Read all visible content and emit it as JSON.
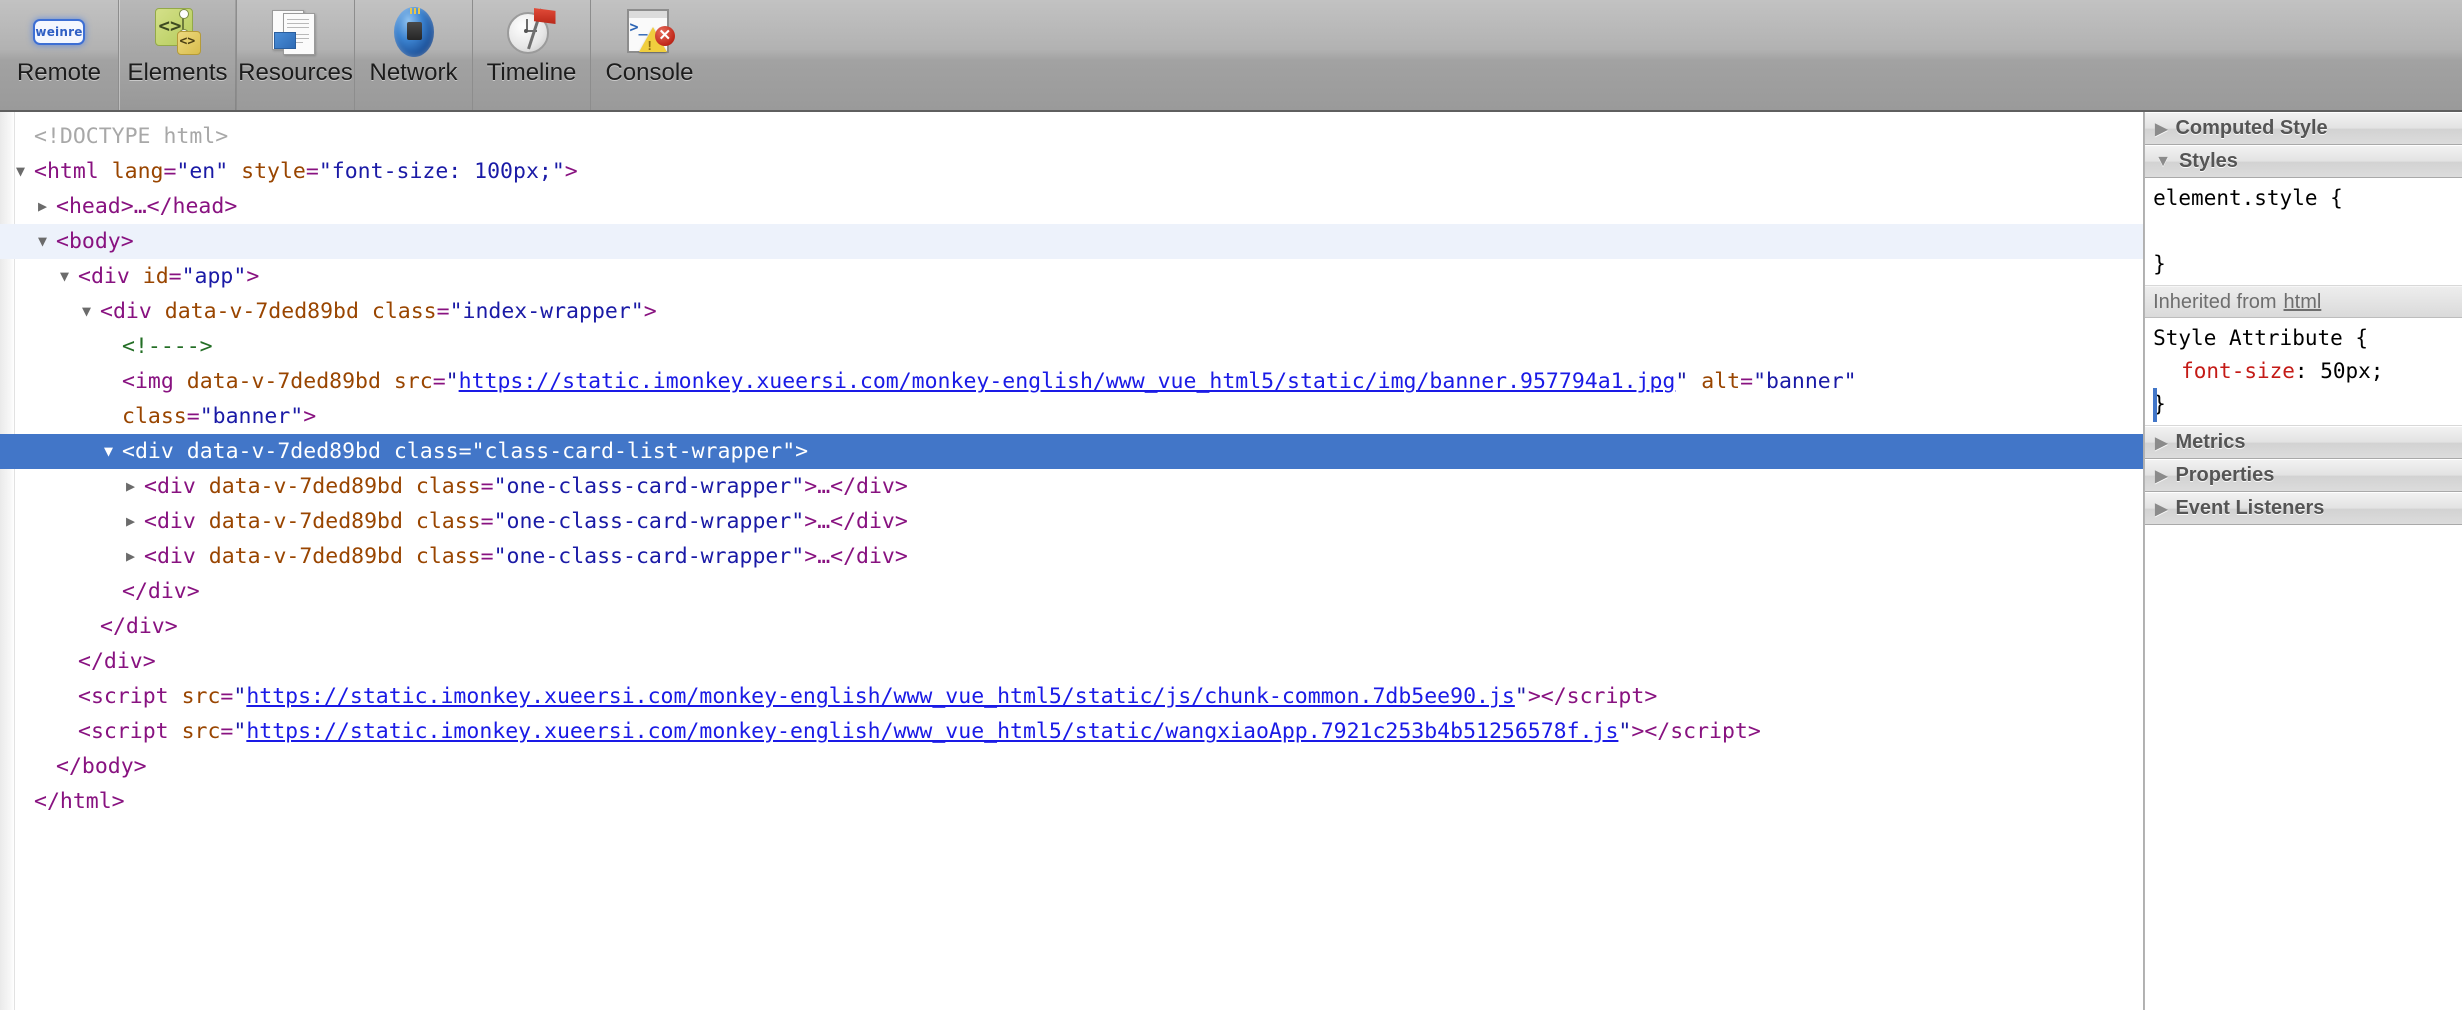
{
  "toolbar": {
    "items": [
      {
        "label": "Remote",
        "icon": "weinre-logo-icon",
        "selected": false
      },
      {
        "label": "Elements",
        "icon": "elements-icon",
        "selected": true
      },
      {
        "label": "Resources",
        "icon": "resources-icon",
        "selected": false
      },
      {
        "label": "Network",
        "icon": "network-icon",
        "selected": false
      },
      {
        "label": "Timeline",
        "icon": "timeline-icon",
        "selected": false
      },
      {
        "label": "Console",
        "icon": "console-icon",
        "selected": false
      }
    ],
    "logo_text": "weinre"
  },
  "dom_tree": {
    "rows": [
      {
        "indent": 0,
        "twisty": "none",
        "state": "normal",
        "parts": [
          {
            "t": "doctype",
            "v": "<!DOCTYPE html>"
          }
        ]
      },
      {
        "indent": 0,
        "twisty": "open",
        "state": "normal",
        "parts": [
          {
            "t": "punct",
            "v": "<"
          },
          {
            "t": "tag",
            "v": "html"
          },
          {
            "t": "sp",
            "v": " "
          },
          {
            "t": "attr",
            "v": "lang"
          },
          {
            "t": "punct",
            "v": "="
          },
          {
            "t": "val",
            "v": "\"en\""
          },
          {
            "t": "sp",
            "v": " "
          },
          {
            "t": "attr",
            "v": "style"
          },
          {
            "t": "punct",
            "v": "="
          },
          {
            "t": "val",
            "v": "\"font-size: 100px;\""
          },
          {
            "t": "punct",
            "v": ">"
          }
        ]
      },
      {
        "indent": 1,
        "twisty": "closed",
        "state": "normal",
        "parts": [
          {
            "t": "punct",
            "v": "<"
          },
          {
            "t": "tag",
            "v": "head"
          },
          {
            "t": "punct",
            "v": ">"
          },
          {
            "t": "ellip",
            "v": "…"
          },
          {
            "t": "punct",
            "v": "</"
          },
          {
            "t": "tag",
            "v": "head"
          },
          {
            "t": "punct",
            "v": ">"
          }
        ]
      },
      {
        "indent": 1,
        "twisty": "open",
        "state": "hover",
        "parts": [
          {
            "t": "punct",
            "v": "<"
          },
          {
            "t": "tag",
            "v": "body"
          },
          {
            "t": "punct",
            "v": ">"
          }
        ]
      },
      {
        "indent": 2,
        "twisty": "open",
        "state": "normal",
        "parts": [
          {
            "t": "punct",
            "v": "<"
          },
          {
            "t": "tag",
            "v": "div"
          },
          {
            "t": "sp",
            "v": " "
          },
          {
            "t": "attr",
            "v": "id"
          },
          {
            "t": "punct",
            "v": "="
          },
          {
            "t": "val",
            "v": "\"app\""
          },
          {
            "t": "punct",
            "v": ">"
          }
        ]
      },
      {
        "indent": 3,
        "twisty": "open",
        "state": "normal",
        "parts": [
          {
            "t": "punct",
            "v": "<"
          },
          {
            "t": "tag",
            "v": "div"
          },
          {
            "t": "sp",
            "v": " "
          },
          {
            "t": "attr",
            "v": "data-v-7ded89bd"
          },
          {
            "t": "sp",
            "v": " "
          },
          {
            "t": "attr",
            "v": "class"
          },
          {
            "t": "punct",
            "v": "="
          },
          {
            "t": "val",
            "v": "\"index-wrapper\""
          },
          {
            "t": "punct",
            "v": ">"
          }
        ]
      },
      {
        "indent": 4,
        "twisty": "none",
        "state": "normal",
        "parts": [
          {
            "t": "comment",
            "v": "<!---->"
          }
        ]
      },
      {
        "indent": 4,
        "twisty": "none",
        "state": "normal",
        "parts": [
          {
            "t": "punct",
            "v": "<"
          },
          {
            "t": "tag",
            "v": "img"
          },
          {
            "t": "sp",
            "v": " "
          },
          {
            "t": "attr",
            "v": "data-v-7ded89bd"
          },
          {
            "t": "sp",
            "v": " "
          },
          {
            "t": "attr",
            "v": "src"
          },
          {
            "t": "punct",
            "v": "="
          },
          {
            "t": "val",
            "v": "\""
          },
          {
            "t": "link",
            "v": "https://static.imonkey.xueersi.com/monkey-english/www_vue_html5/static/img/banner.957794a1.jpg"
          },
          {
            "t": "val",
            "v": "\""
          },
          {
            "t": "sp",
            "v": " "
          },
          {
            "t": "attr",
            "v": "alt"
          },
          {
            "t": "punct",
            "v": "="
          },
          {
            "t": "val",
            "v": "\"banner\""
          }
        ]
      },
      {
        "indent": 4,
        "twisty": "none",
        "state": "normal",
        "parts": [
          {
            "t": "attr",
            "v": "class"
          },
          {
            "t": "punct",
            "v": "="
          },
          {
            "t": "val",
            "v": "\"banner\""
          },
          {
            "t": "punct",
            "v": ">"
          }
        ]
      },
      {
        "indent": 4,
        "twisty": "open",
        "state": "selected",
        "parts": [
          {
            "t": "punct",
            "v": "<"
          },
          {
            "t": "tag",
            "v": "div"
          },
          {
            "t": "sp",
            "v": " "
          },
          {
            "t": "attr",
            "v": "data-v-7ded89bd"
          },
          {
            "t": "sp",
            "v": " "
          },
          {
            "t": "attr",
            "v": "class"
          },
          {
            "t": "punct",
            "v": "="
          },
          {
            "t": "val",
            "v": "\"class-card-list-wrapper\""
          },
          {
            "t": "punct",
            "v": ">"
          }
        ]
      },
      {
        "indent": 5,
        "twisty": "closed",
        "state": "normal",
        "parts": [
          {
            "t": "punct",
            "v": "<"
          },
          {
            "t": "tag",
            "v": "div"
          },
          {
            "t": "sp",
            "v": " "
          },
          {
            "t": "attr",
            "v": "data-v-7ded89bd"
          },
          {
            "t": "sp",
            "v": " "
          },
          {
            "t": "attr",
            "v": "class"
          },
          {
            "t": "punct",
            "v": "="
          },
          {
            "t": "val",
            "v": "\"one-class-card-wrapper\""
          },
          {
            "t": "punct",
            "v": ">"
          },
          {
            "t": "ellip",
            "v": "…"
          },
          {
            "t": "punct",
            "v": "</"
          },
          {
            "t": "tag",
            "v": "div"
          },
          {
            "t": "punct",
            "v": ">"
          }
        ]
      },
      {
        "indent": 5,
        "twisty": "closed",
        "state": "normal",
        "parts": [
          {
            "t": "punct",
            "v": "<"
          },
          {
            "t": "tag",
            "v": "div"
          },
          {
            "t": "sp",
            "v": " "
          },
          {
            "t": "attr",
            "v": "data-v-7ded89bd"
          },
          {
            "t": "sp",
            "v": " "
          },
          {
            "t": "attr",
            "v": "class"
          },
          {
            "t": "punct",
            "v": "="
          },
          {
            "t": "val",
            "v": "\"one-class-card-wrapper\""
          },
          {
            "t": "punct",
            "v": ">"
          },
          {
            "t": "ellip",
            "v": "…"
          },
          {
            "t": "punct",
            "v": "</"
          },
          {
            "t": "tag",
            "v": "div"
          },
          {
            "t": "punct",
            "v": ">"
          }
        ]
      },
      {
        "indent": 5,
        "twisty": "closed",
        "state": "normal",
        "parts": [
          {
            "t": "punct",
            "v": "<"
          },
          {
            "t": "tag",
            "v": "div"
          },
          {
            "t": "sp",
            "v": " "
          },
          {
            "t": "attr",
            "v": "data-v-7ded89bd"
          },
          {
            "t": "sp",
            "v": " "
          },
          {
            "t": "attr",
            "v": "class"
          },
          {
            "t": "punct",
            "v": "="
          },
          {
            "t": "val",
            "v": "\"one-class-card-wrapper\""
          },
          {
            "t": "punct",
            "v": ">"
          },
          {
            "t": "ellip",
            "v": "…"
          },
          {
            "t": "punct",
            "v": "</"
          },
          {
            "t": "tag",
            "v": "div"
          },
          {
            "t": "punct",
            "v": ">"
          }
        ]
      },
      {
        "indent": 4,
        "twisty": "none",
        "state": "normal",
        "parts": [
          {
            "t": "punct",
            "v": "</"
          },
          {
            "t": "tag",
            "v": "div"
          },
          {
            "t": "punct",
            "v": ">"
          }
        ]
      },
      {
        "indent": 3,
        "twisty": "none",
        "state": "normal",
        "parts": [
          {
            "t": "punct",
            "v": "</"
          },
          {
            "t": "tag",
            "v": "div"
          },
          {
            "t": "punct",
            "v": ">"
          }
        ]
      },
      {
        "indent": 2,
        "twisty": "none",
        "state": "normal",
        "parts": [
          {
            "t": "punct",
            "v": "</"
          },
          {
            "t": "tag",
            "v": "div"
          },
          {
            "t": "punct",
            "v": ">"
          }
        ]
      },
      {
        "indent": 2,
        "twisty": "none",
        "state": "normal",
        "parts": [
          {
            "t": "punct",
            "v": "<"
          },
          {
            "t": "tag",
            "v": "script"
          },
          {
            "t": "sp",
            "v": " "
          },
          {
            "t": "attr",
            "v": "src"
          },
          {
            "t": "punct",
            "v": "="
          },
          {
            "t": "val",
            "v": "\""
          },
          {
            "t": "link",
            "v": "https://static.imonkey.xueersi.com/monkey-english/www_vue_html5/static/js/chunk-common.7db5ee90.js"
          },
          {
            "t": "val",
            "v": "\""
          },
          {
            "t": "punct",
            "v": ">"
          },
          {
            "t": "punct",
            "v": "</"
          },
          {
            "t": "tag",
            "v": "script"
          },
          {
            "t": "punct",
            "v": ">"
          }
        ]
      },
      {
        "indent": 2,
        "twisty": "none",
        "state": "normal",
        "parts": [
          {
            "t": "punct",
            "v": "<"
          },
          {
            "t": "tag",
            "v": "script"
          },
          {
            "t": "sp",
            "v": " "
          },
          {
            "t": "attr",
            "v": "src"
          },
          {
            "t": "punct",
            "v": "="
          },
          {
            "t": "val",
            "v": "\""
          },
          {
            "t": "link",
            "v": "https://static.imonkey.xueersi.com/monkey-english/www_vue_html5/static/wangxiaoApp.7921c253b4b51256578f.js"
          },
          {
            "t": "val",
            "v": "\""
          },
          {
            "t": "punct",
            "v": ">"
          },
          {
            "t": "punct",
            "v": "</"
          },
          {
            "t": "tag",
            "v": "script"
          },
          {
            "t": "punct",
            "v": ">"
          }
        ]
      },
      {
        "indent": 1,
        "twisty": "none",
        "state": "normal",
        "parts": [
          {
            "t": "punct",
            "v": "</"
          },
          {
            "t": "tag",
            "v": "body"
          },
          {
            "t": "punct",
            "v": ">"
          }
        ]
      },
      {
        "indent": 0,
        "twisty": "none",
        "state": "normal",
        "parts": [
          {
            "t": "punct",
            "v": "</"
          },
          {
            "t": "tag",
            "v": "html"
          },
          {
            "t": "punct",
            "v": ">"
          }
        ]
      }
    ]
  },
  "sidebar": {
    "sections": [
      {
        "title": "Computed Style",
        "expanded": false
      },
      {
        "title": "Styles",
        "expanded": true
      },
      {
        "title": "Metrics",
        "expanded": false
      },
      {
        "title": "Properties",
        "expanded": false
      },
      {
        "title": "Event Listeners",
        "expanded": false
      }
    ],
    "element_style": {
      "selector": "element.style {",
      "close": "}"
    },
    "inherited": {
      "label": "Inherited from",
      "source": "html",
      "selector": "Style Attribute {",
      "rule_prop": "font-size",
      "rule_sep": ": ",
      "rule_value": "50px;",
      "close": "}"
    }
  },
  "colors": {
    "selection_blue": "#4276c8",
    "hover_row": "#edf2fb",
    "tag": "#881280",
    "attr_name": "#994500",
    "attr_value": "#1a1aa6",
    "comment": "#236e25",
    "link": "#1a1ae6",
    "css_property": "#c41a16",
    "toolbar_bg": "#b0b0b0"
  }
}
